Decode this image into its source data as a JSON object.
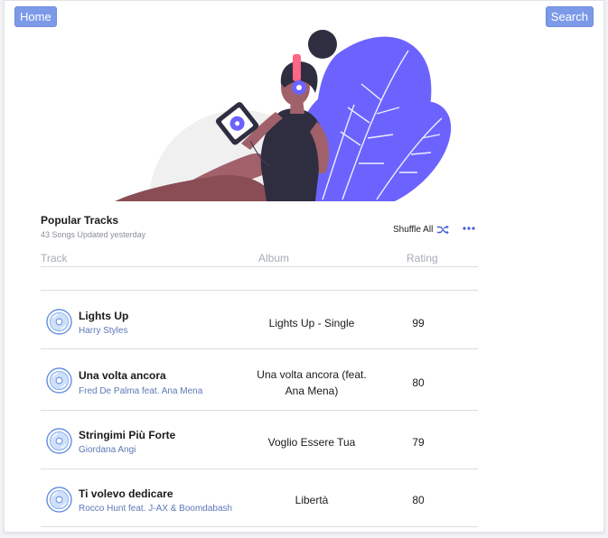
{
  "nav": {
    "home_label": "Home",
    "search_label": "Search"
  },
  "section": {
    "title": "Popular Tracks",
    "subtitle": "43 Songs Updated yesterday",
    "shuffle_label": "Shuffle All",
    "more_label": "•••"
  },
  "table": {
    "headers": {
      "track": "Track",
      "album": "Album",
      "rating": "Rating"
    },
    "rows": [
      {
        "title": "Lights Up",
        "artist": "Harry Styles",
        "album": "Lights Up - Single",
        "rating": "99"
      },
      {
        "title": "Una volta ancora",
        "artist": "Fred De Palma feat. Ana Mena",
        "album": "Una volta ancora (feat. Ana Mena)",
        "rating": "80"
      },
      {
        "title": "Stringimi Più Forte",
        "artist": "Giordana Angi",
        "album": "Voglio Essere Tua",
        "rating": "79"
      },
      {
        "title": "Ti volevo dedicare",
        "artist": "Rocco Hunt feat. J-AX & Boomdabash",
        "album": "Libertà",
        "rating": "80"
      }
    ]
  },
  "colors": {
    "accent": "#7d9ae8",
    "link": "#5d78b6",
    "icon": "#3f5fd0",
    "illustration_plant": "#6c63ff",
    "illustration_headphones": "#ff6584"
  },
  "icons": {
    "shuffle": "shuffle-icon",
    "more": "more-icon",
    "disc": "vinyl-disc-icon"
  }
}
